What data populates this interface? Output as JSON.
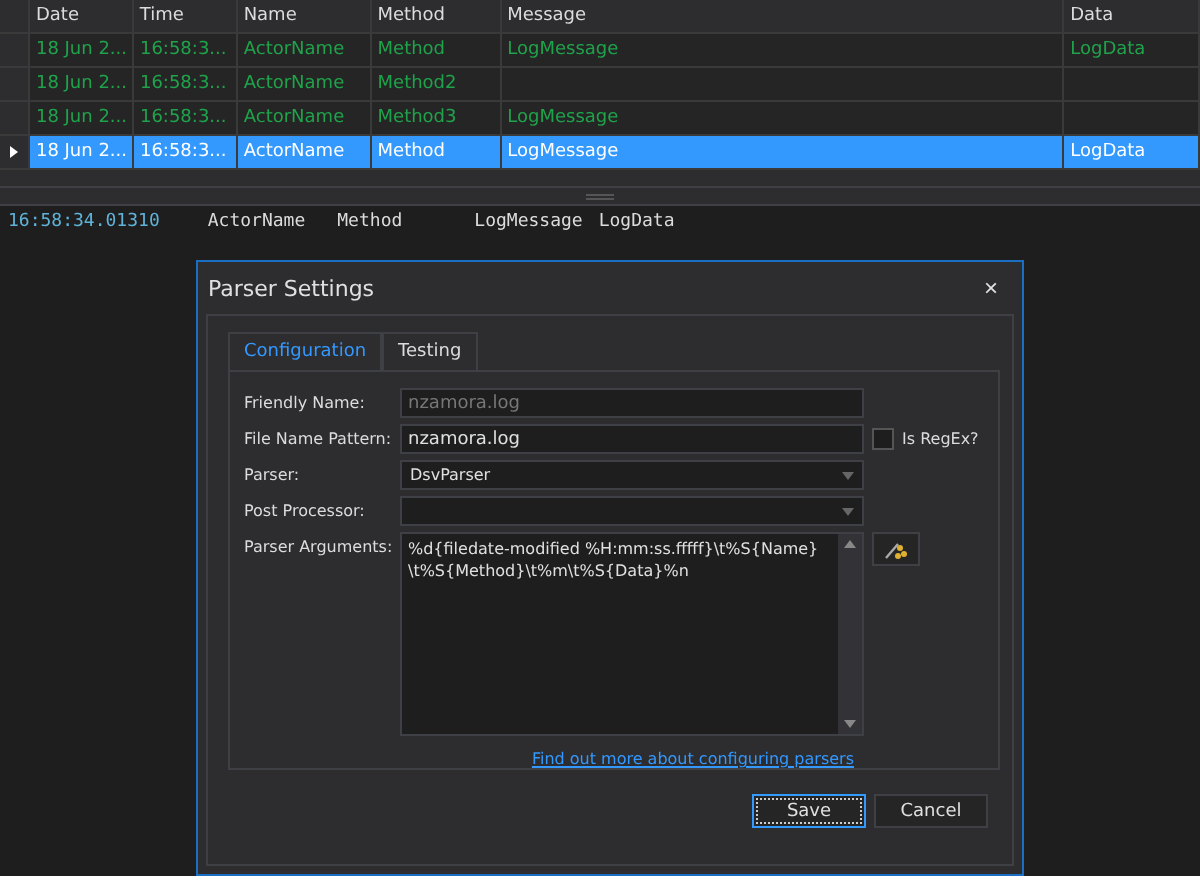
{
  "grid": {
    "columns": [
      "Date",
      "Time",
      "Name",
      "Method",
      "Message",
      "Data"
    ],
    "rows": [
      {
        "cells": [
          "18 Jun 2...",
          "16:58:3...",
          "ActorName",
          "Method",
          "LogMessage",
          "LogData"
        ],
        "selected": false
      },
      {
        "cells": [
          "18 Jun 2...",
          "16:58:3...",
          "ActorName",
          "Method2",
          "",
          ""
        ],
        "selected": false
      },
      {
        "cells": [
          "18 Jun 2...",
          "16:58:3...",
          "ActorName",
          "Method3",
          "LogMessage",
          ""
        ],
        "selected": false
      },
      {
        "cells": [
          "18 Jun 2...",
          "16:58:3...",
          "ActorName",
          "Method",
          "LogMessage",
          "LogData"
        ],
        "selected": true
      }
    ]
  },
  "detail": [
    "16:58:34.01310",
    "ActorName",
    "Method",
    "LogMessage",
    "LogData"
  ],
  "dialog": {
    "title": "Parser Settings",
    "close": "×",
    "tabs": [
      {
        "label": "Configuration",
        "selected": true
      },
      {
        "label": "Testing",
        "selected": false
      }
    ],
    "fields": [
      {
        "kind": "text",
        "label": "Friendly Name:",
        "placeholder": "nzamora.log"
      },
      {
        "kind": "text",
        "label": "File Name Pattern:",
        "value": "nzamora.log",
        "checkbox": {
          "label": "Is RegEx?",
          "checked": false
        }
      },
      {
        "kind": "select",
        "label": "Parser:",
        "value": "DsvParser"
      },
      {
        "kind": "select",
        "label": "Post Processor:"
      },
      {
        "kind": "textarea",
        "label": "Parser Arguments:",
        "value": "%d{filedate-modified %H:mm:ss.fffff}\\t%S{Name}\\t%S{Method}\\t%m\\t%S{Data}%n"
      }
    ],
    "link": "Find out more about configuring parsers",
    "buttons": [
      {
        "label": "Save",
        "selected": true
      },
      {
        "label": "Cancel",
        "selected": false
      }
    ]
  }
}
